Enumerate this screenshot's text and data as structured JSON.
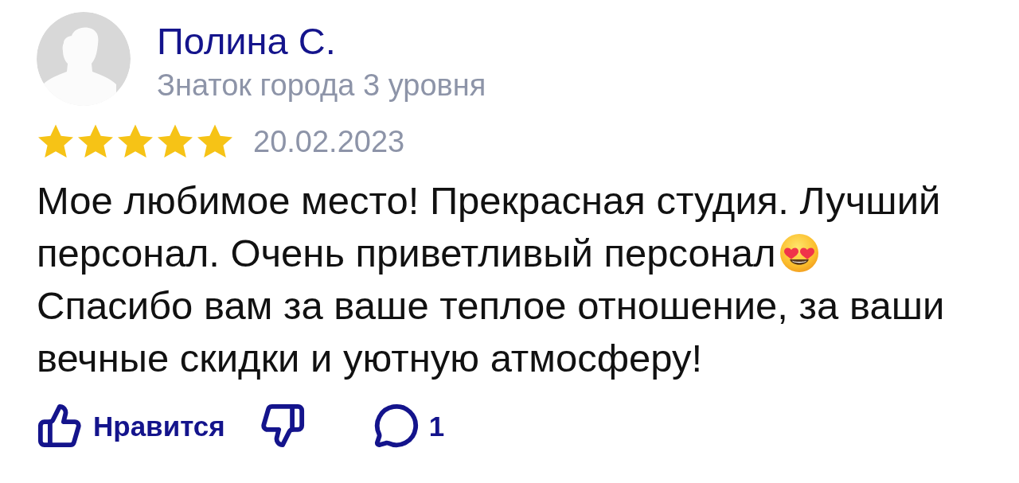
{
  "author": {
    "name": "Полина С.",
    "level": "Знаток города 3 уровня"
  },
  "review": {
    "stars": 5,
    "date": "20.02.2023",
    "body": [
      {
        "kind": "line",
        "text": "Мое любимое место! Прекрасная студия. Лучший"
      },
      {
        "kind": "line_with_icon",
        "text": "персонал. Очень приветливый персонал"
      },
      {
        "kind": "paragraph",
        "text": "Спасибо вам за ваше теплое отношение, за ваши вечные скидки и уютную атмосферу!"
      }
    ]
  },
  "actions": [
    {
      "kind": "like",
      "label": "Нравится"
    },
    {
      "kind": "dislike"
    },
    {
      "kind": "comments",
      "count": "1"
    }
  ]
}
